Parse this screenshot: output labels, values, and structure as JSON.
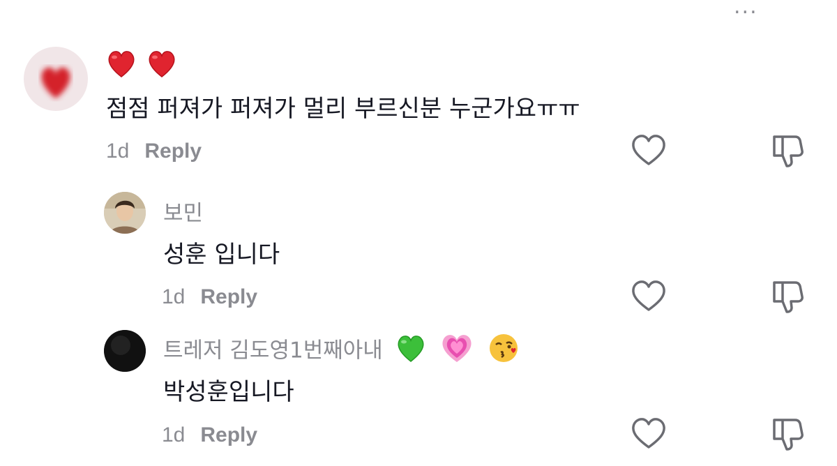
{
  "header": {
    "more_label": "...",
    "close_icon": "close-icon"
  },
  "comments": [
    {
      "avatar_icon": "heart-avatar",
      "name_icons": [
        "red-heart-emoji",
        "red-heart-emoji"
      ],
      "text": "점점 퍼져가 퍼져가 멀리 부르신분 누군가요ㅠㅠ",
      "age": "1d",
      "reply_label": "Reply",
      "like_icon": "heart-outline-icon",
      "dislike_icon": "thumbs-down-icon"
    },
    {
      "avatar_icon": "user-photo-avatar",
      "name": "보민",
      "text": "성훈 입니다",
      "age": "1d",
      "reply_label": "Reply",
      "like_icon": "heart-outline-icon",
      "dislike_icon": "thumbs-down-icon"
    },
    {
      "avatar_icon": "dark-avatar",
      "name": "트레저 김도영1번째아내",
      "name_emojis": [
        "green-heart-emoji",
        "growing-heart-emoji",
        "kissing-face-emoji"
      ],
      "text": "박성훈입니다",
      "age": "1d",
      "reply_label": "Reply",
      "like_icon": "heart-outline-icon",
      "dislike_icon": "thumbs-down-icon"
    }
  ],
  "colors": {
    "text_primary": "#161823",
    "text_secondary": "#8a8b91",
    "icon": "#6b6c72"
  }
}
